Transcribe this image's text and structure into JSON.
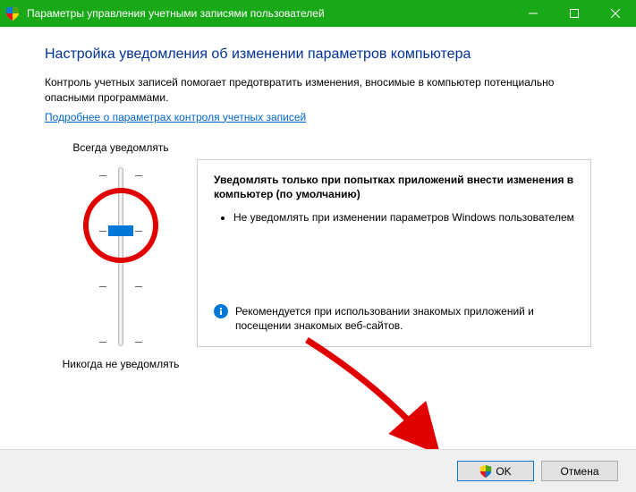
{
  "titlebar": {
    "title": "Параметры управления учетными записями пользователей"
  },
  "heading": "Настройка уведомления об изменении параметров компьютера",
  "description": "Контроль учетных записей помогает предотвратить изменения, вносимые в компьютер потенциально опасными программами.",
  "link": "Подробнее о параметрах контроля учетных записей",
  "slider": {
    "top_label": "Всегда уведомлять",
    "bottom_label": "Никогда не уведомлять"
  },
  "infobox": {
    "title": "Уведомлять только при попытках приложений внести изменения в компьютер (по умолчанию)",
    "item1": "Не уведомлять при изменении параметров Windows пользователем",
    "recommendation": "Рекомендуется при использовании знакомых приложений и посещении знакомых веб-сайтов."
  },
  "buttons": {
    "ok": "OK",
    "cancel": "Отмена"
  }
}
